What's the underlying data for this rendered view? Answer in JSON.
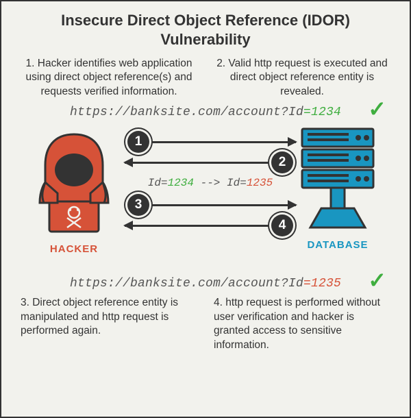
{
  "title": "Insecure Direct Object Reference (IDOR) Vulnerability",
  "steps": {
    "s1": "1. Hacker identifies web application using direct object reference(s) and requests verified information.",
    "s2": "2. Valid http request is executed and direct object reference entity is revealed.",
    "s3": "3. Direct object reference entity is manipulated and http request is performed again.",
    "s4": "4. http request is performed without user verification and hacker is granted access to sensitive information."
  },
  "url1": {
    "base": "https://banksite.com/account?Id",
    "eq": "=",
    "id": "1234"
  },
  "url2": {
    "base": "https://banksite.com/account?Id",
    "eq": "=",
    "id": "1235"
  },
  "idchange": {
    "prefix1": "Id=",
    "val1": "1234",
    "arrow": " --> ",
    "prefix2": "Id=",
    "val2": "1235"
  },
  "labels": {
    "hacker": "HACKER",
    "database": "DATABASE"
  },
  "badges": {
    "b1": "1",
    "b2": "2",
    "b3": "3",
    "b4": "4"
  },
  "check": "✓"
}
